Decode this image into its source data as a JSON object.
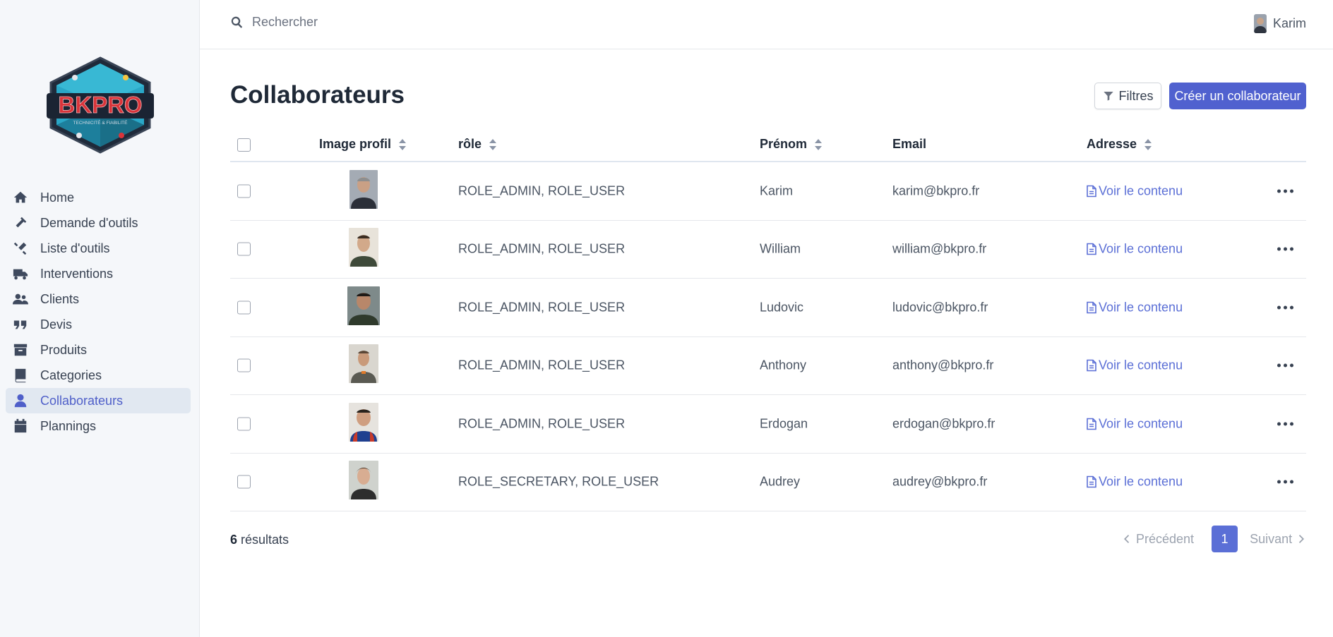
{
  "search": {
    "placeholder": "Rechercher"
  },
  "user": {
    "name": "Karim"
  },
  "brand": {
    "logo_text": "BKPRO",
    "tagline": "TECHNICITÉ & FIABILITÉ"
  },
  "sidebar": {
    "items": [
      {
        "label": "Home",
        "icon": "home-icon"
      },
      {
        "label": "Demande d'outils",
        "icon": "hammer-icon"
      },
      {
        "label": "Liste d'outils",
        "icon": "tools-icon"
      },
      {
        "label": "Interventions",
        "icon": "truck-icon"
      },
      {
        "label": "Clients",
        "icon": "users-icon"
      },
      {
        "label": "Devis",
        "icon": "quote-icon"
      },
      {
        "label": "Produits",
        "icon": "archive-icon"
      },
      {
        "label": "Categories",
        "icon": "book-icon"
      },
      {
        "label": "Collaborateurs",
        "icon": "user-icon",
        "active": true
      },
      {
        "label": "Plannings",
        "icon": "calendar-icon"
      }
    ]
  },
  "page": {
    "title": "Collaborateurs",
    "filter_label": "Filtres",
    "create_label": "Créer un collaborateur"
  },
  "table": {
    "columns": [
      "Image profil",
      "rôle",
      "Prénom",
      "Email",
      "Adresse"
    ],
    "rows": [
      {
        "role": "ROLE_ADMIN, ROLE_USER",
        "firstname": "Karim",
        "email": "karim@bkpro.fr",
        "address_link": "Voir le contenu"
      },
      {
        "role": "ROLE_ADMIN, ROLE_USER",
        "firstname": "William",
        "email": "william@bkpro.fr",
        "address_link": "Voir le contenu"
      },
      {
        "role": "ROLE_ADMIN, ROLE_USER",
        "firstname": "Ludovic",
        "email": "ludovic@bkpro.fr",
        "address_link": "Voir le contenu"
      },
      {
        "role": "ROLE_ADMIN, ROLE_USER",
        "firstname": "Anthony",
        "email": "anthony@bkpro.fr",
        "address_link": "Voir le contenu"
      },
      {
        "role": "ROLE_ADMIN, ROLE_USER",
        "firstname": "Erdogan",
        "email": "erdogan@bkpro.fr",
        "address_link": "Voir le contenu"
      },
      {
        "role": "ROLE_SECRETARY, ROLE_USER",
        "firstname": "Audrey",
        "email": "audrey@bkpro.fr",
        "address_link": "Voir le contenu"
      }
    ]
  },
  "footer": {
    "count": "6",
    "count_label": "résultats",
    "prev_label": "Précédent",
    "current_page": "1",
    "next_label": "Suivant"
  },
  "colors": {
    "accent": "#5061cf",
    "link": "#5b6fd6",
    "sidebar_bg": "#f5f7fa",
    "active_bg": "#e1e8f1"
  }
}
